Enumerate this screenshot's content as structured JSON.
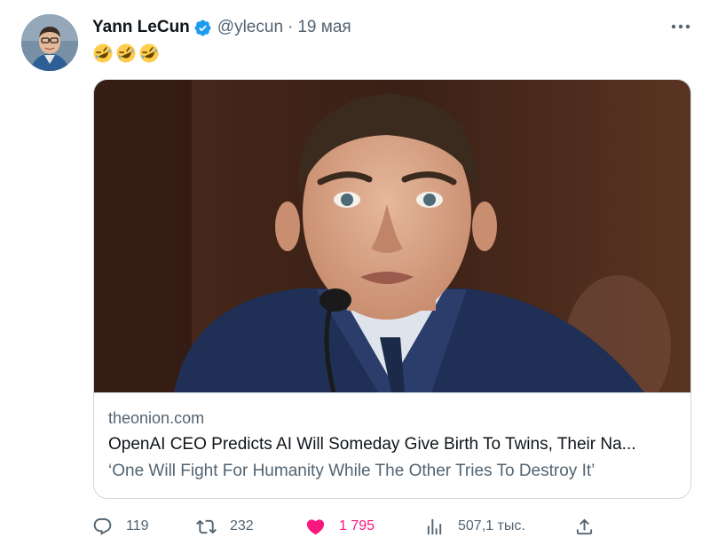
{
  "tweet": {
    "author_name": "Yann LeCun",
    "handle": "@ylecun",
    "separator": "·",
    "timestamp": "19 мая",
    "text_emojis": [
      "rolling-on-floor-laughing",
      "rolling-on-floor-laughing",
      "rolling-on-floor-laughing"
    ]
  },
  "card": {
    "domain": "theonion.com",
    "title": "OpenAI CEO Predicts AI Will Someday Give Birth To Twins, Their Na...",
    "description": "‘One Will Fight For Humanity While The Other Tries To Destroy It’"
  },
  "actions": {
    "replies": "119",
    "retweets": "232",
    "likes": "1 795",
    "views": "507,1 тыс."
  },
  "colors": {
    "text_primary": "#0f1419",
    "text_secondary": "#536471",
    "verified_blue": "#1d9bf0",
    "like_pink": "#f91880",
    "border": "#cfd9de"
  },
  "icons": {
    "verified": "verified-badge-icon",
    "more": "more-horizontal-icon",
    "reply": "reply-icon",
    "retweet": "retweet-icon",
    "like": "heart-filled-icon",
    "views": "views-bar-chart-icon",
    "share": "share-upload-icon"
  }
}
